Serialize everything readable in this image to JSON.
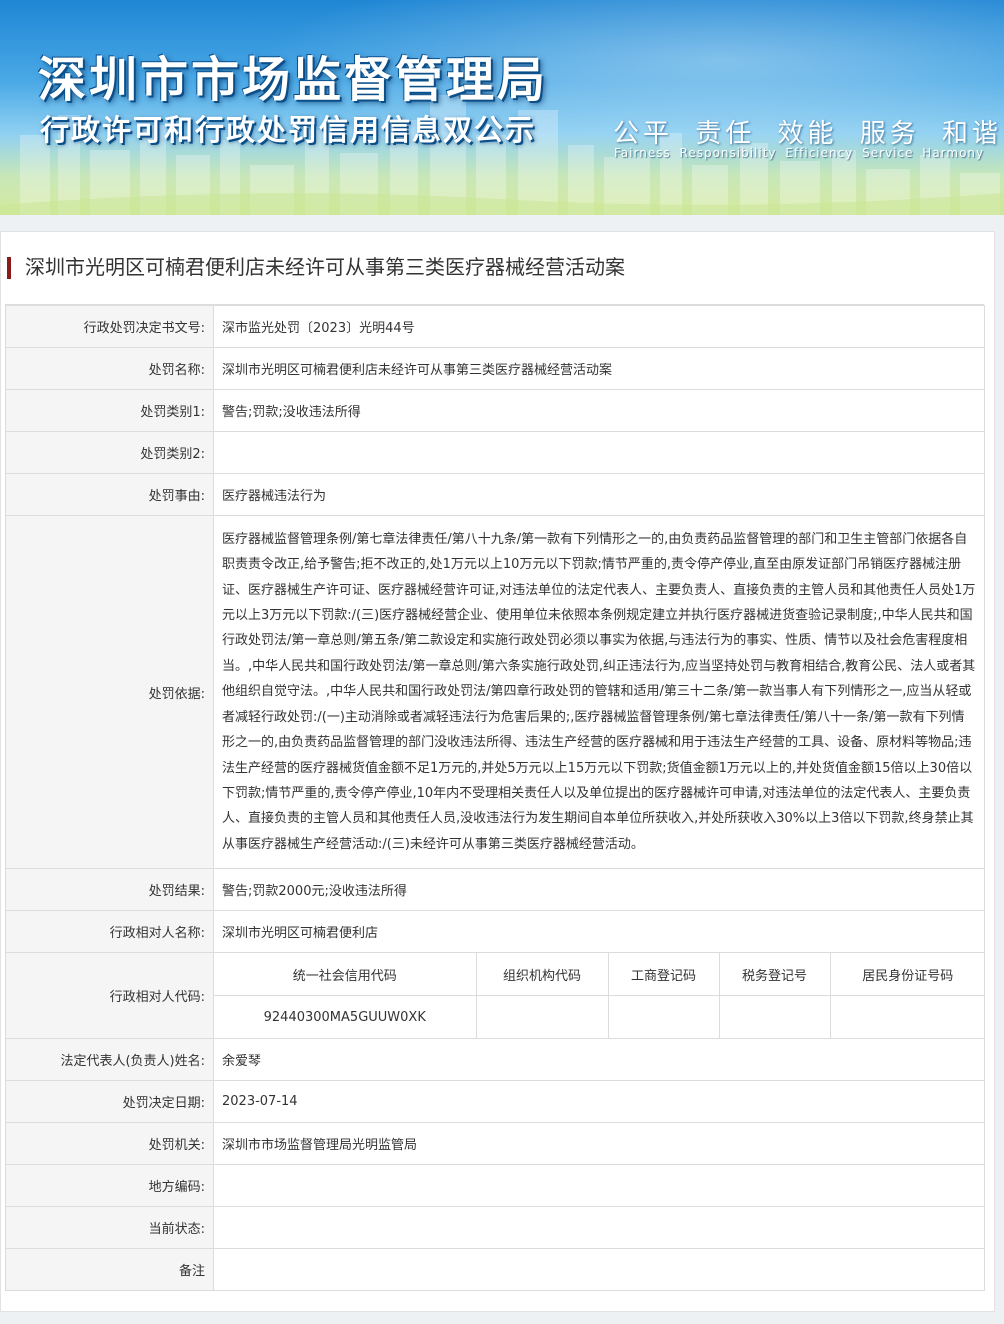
{
  "header": {
    "title_main": "深圳市市场监督管理局",
    "title_sub": "行政许可和行政处罚信用信息双公示",
    "slogan_cn": "公平 责任 效能 服务 和谐",
    "slogan_en": "Fairness Responsibility Efficiency Service Harmony"
  },
  "case": {
    "title": "深圳市光明区可楠君便利店未经许可从事第三类医疗器械经营活动案"
  },
  "rows": {
    "decision_no": {
      "label": "行政处罚决定书文号:",
      "value": "深市监光处罚〔2023〕光明44号"
    },
    "penalty_name": {
      "label": "处罚名称:",
      "value": "深圳市光明区可楠君便利店未经许可从事第三类医疗器械经营活动案"
    },
    "category1": {
      "label": "处罚类别1:",
      "value": "警告;罚款;没收违法所得"
    },
    "category2": {
      "label": "处罚类别2:",
      "value": ""
    },
    "reason": {
      "label": "处罚事由:",
      "value": "医疗器械违法行为"
    },
    "basis": {
      "label": "处罚依据:",
      "value": "医疗器械监督管理条例/第七章法律责任/第八十九条/第一款有下列情形之一的,由负责药品监督管理的部门和卫生主管部门依据各自职责责令改正,给予警告;拒不改正的,处1万元以上10万元以下罚款;情节严重的,责令停产停业,直至由原发证部门吊销医疗器械注册证、医疗器械生产许可证、医疗器械经营许可证,对违法单位的法定代表人、主要负责人、直接负责的主管人员和其他责任人员处1万元以上3万元以下罚款:/(三)医疗器械经营企业、使用单位未依照本条例规定建立并执行医疗器械进货查验记录制度;,中华人民共和国行政处罚法/第一章总则/第五条/第二款设定和实施行政处罚必须以事实为依据,与违法行为的事实、性质、情节以及社会危害程度相当。,中华人民共和国行政处罚法/第一章总则/第六条实施行政处罚,纠正违法行为,应当坚持处罚与教育相结合,教育公民、法人或者其他组织自觉守法。,中华人民共和国行政处罚法/第四章行政处罚的管辖和适用/第三十二条/第一款当事人有下列情形之一,应当从轻或者减轻行政处罚:/(一)主动消除或者减轻违法行为危害后果的;,医疗器械监督管理条例/第七章法律责任/第八十一条/第一款有下列情形之一的,由负责药品监督管理的部门没收违法所得、违法生产经营的医疗器械和用于违法生产经营的工具、设备、原材料等物品;违法生产经营的医疗器械货值金额不足1万元的,并处5万元以上15万元以下罚款;货值金额1万元以上的,并处货值金额15倍以上30倍以下罚款;情节严重的,责令停产停业,10年内不受理相关责任人以及单位提出的医疗器械许可申请,对违法单位的法定代表人、主要负责人、直接负责的主管人员和其他责任人员,没收违法行为发生期间自本单位所获收入,并处所获收入30%以上3倍以下罚款,终身禁止其从事医疗器械生产经营活动:/(三)未经许可从事第三类医疗器械经营活动。"
    },
    "result": {
      "label": "处罚结果:",
      "value": "警告;罚款2000元;没收违法所得"
    },
    "party_name": {
      "label": "行政相对人名称:",
      "value": "深圳市光明区可楠君便利店"
    },
    "party_code": {
      "label": "行政相对人代码:",
      "headers": [
        "统一社会信用代码",
        "组织机构代码",
        "工商登记码",
        "税务登记号",
        "居民身份证号码"
      ],
      "values": [
        "92440300MA5GUUW0XK",
        "",
        "",
        "",
        ""
      ]
    },
    "legal_rep": {
      "label": "法定代表人(负责人)姓名:",
      "value": "余爱琴"
    },
    "decision_date": {
      "label": "处罚决定日期:",
      "value": "2023-07-14"
    },
    "authority": {
      "label": "处罚机关:",
      "value": "深圳市市场监督管理局光明监管局"
    },
    "local_code": {
      "label": "地方编码:",
      "value": ""
    },
    "status": {
      "label": "当前状态:",
      "value": ""
    },
    "remark": {
      "label": "备注",
      "value": ""
    }
  }
}
